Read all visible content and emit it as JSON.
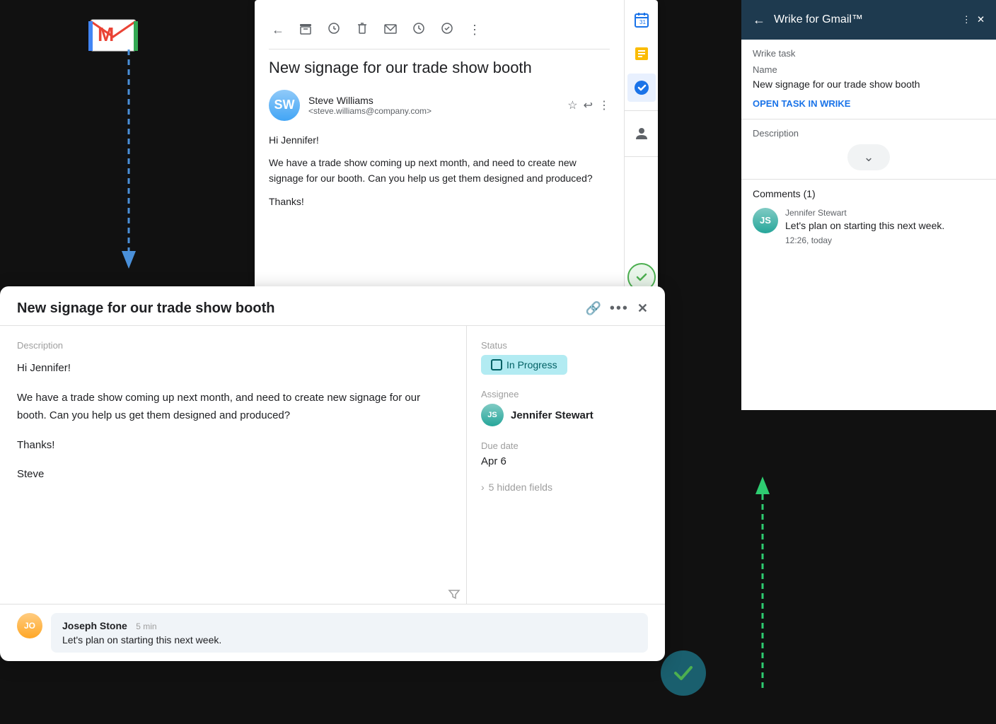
{
  "gmail": {
    "subject": "New signage for our trade show booth",
    "sender_name": "Steve Williams",
    "sender_email": "<steve.williams@company.com>",
    "body_greeting": "Hi Jennifer!",
    "body_line1": "We have a trade show coming up next month, and need to create new signage for our booth. Can you help us get them designed and produced?",
    "body_thanks": "Thanks!"
  },
  "wrike_panel": {
    "title": "Wrike for Gmail™",
    "wrike_task_label": "Wrike task",
    "name_label": "Name",
    "name_value": "New signage for our trade show booth",
    "open_link": "OPEN TASK IN WRIKE",
    "description_label": "Description",
    "comments_title": "Comments (1)",
    "comment_author": "Jennifer Stewart",
    "comment_text": "Let's plan on starting this next week.",
    "comment_time": "12:26, today"
  },
  "task_popup": {
    "title": "New signage for our trade show booth",
    "description_label": "Description",
    "greeting": "Hi Jennifer!",
    "body": "We have a trade show coming up next month, and need to create new signage for our booth. Can you help us get them designed and produced?",
    "thanks": "Thanks!",
    "signature": "Steve",
    "status_label": "Status",
    "status_value": "In Progress",
    "assignee_label": "Assignee",
    "assignee_name": "Jennifer Stewart",
    "due_date_label": "Due date",
    "due_date": "Apr 6",
    "hidden_fields": "5 hidden fields",
    "comment_author": "Joseph Stone",
    "comment_time": "5 min",
    "comment_text": "Let's plan on starting this next week."
  },
  "icons": {
    "back_arrow": "←",
    "archive": "☐",
    "delete": "🗑",
    "mail": "✉",
    "clock": "🕐",
    "check_circle": "✓",
    "more_vert": "⋮",
    "star": "☆",
    "reply": "↩",
    "close": "✕",
    "link": "🔗",
    "filter": "▽",
    "chevron_down": "⌄",
    "expand": "›"
  }
}
